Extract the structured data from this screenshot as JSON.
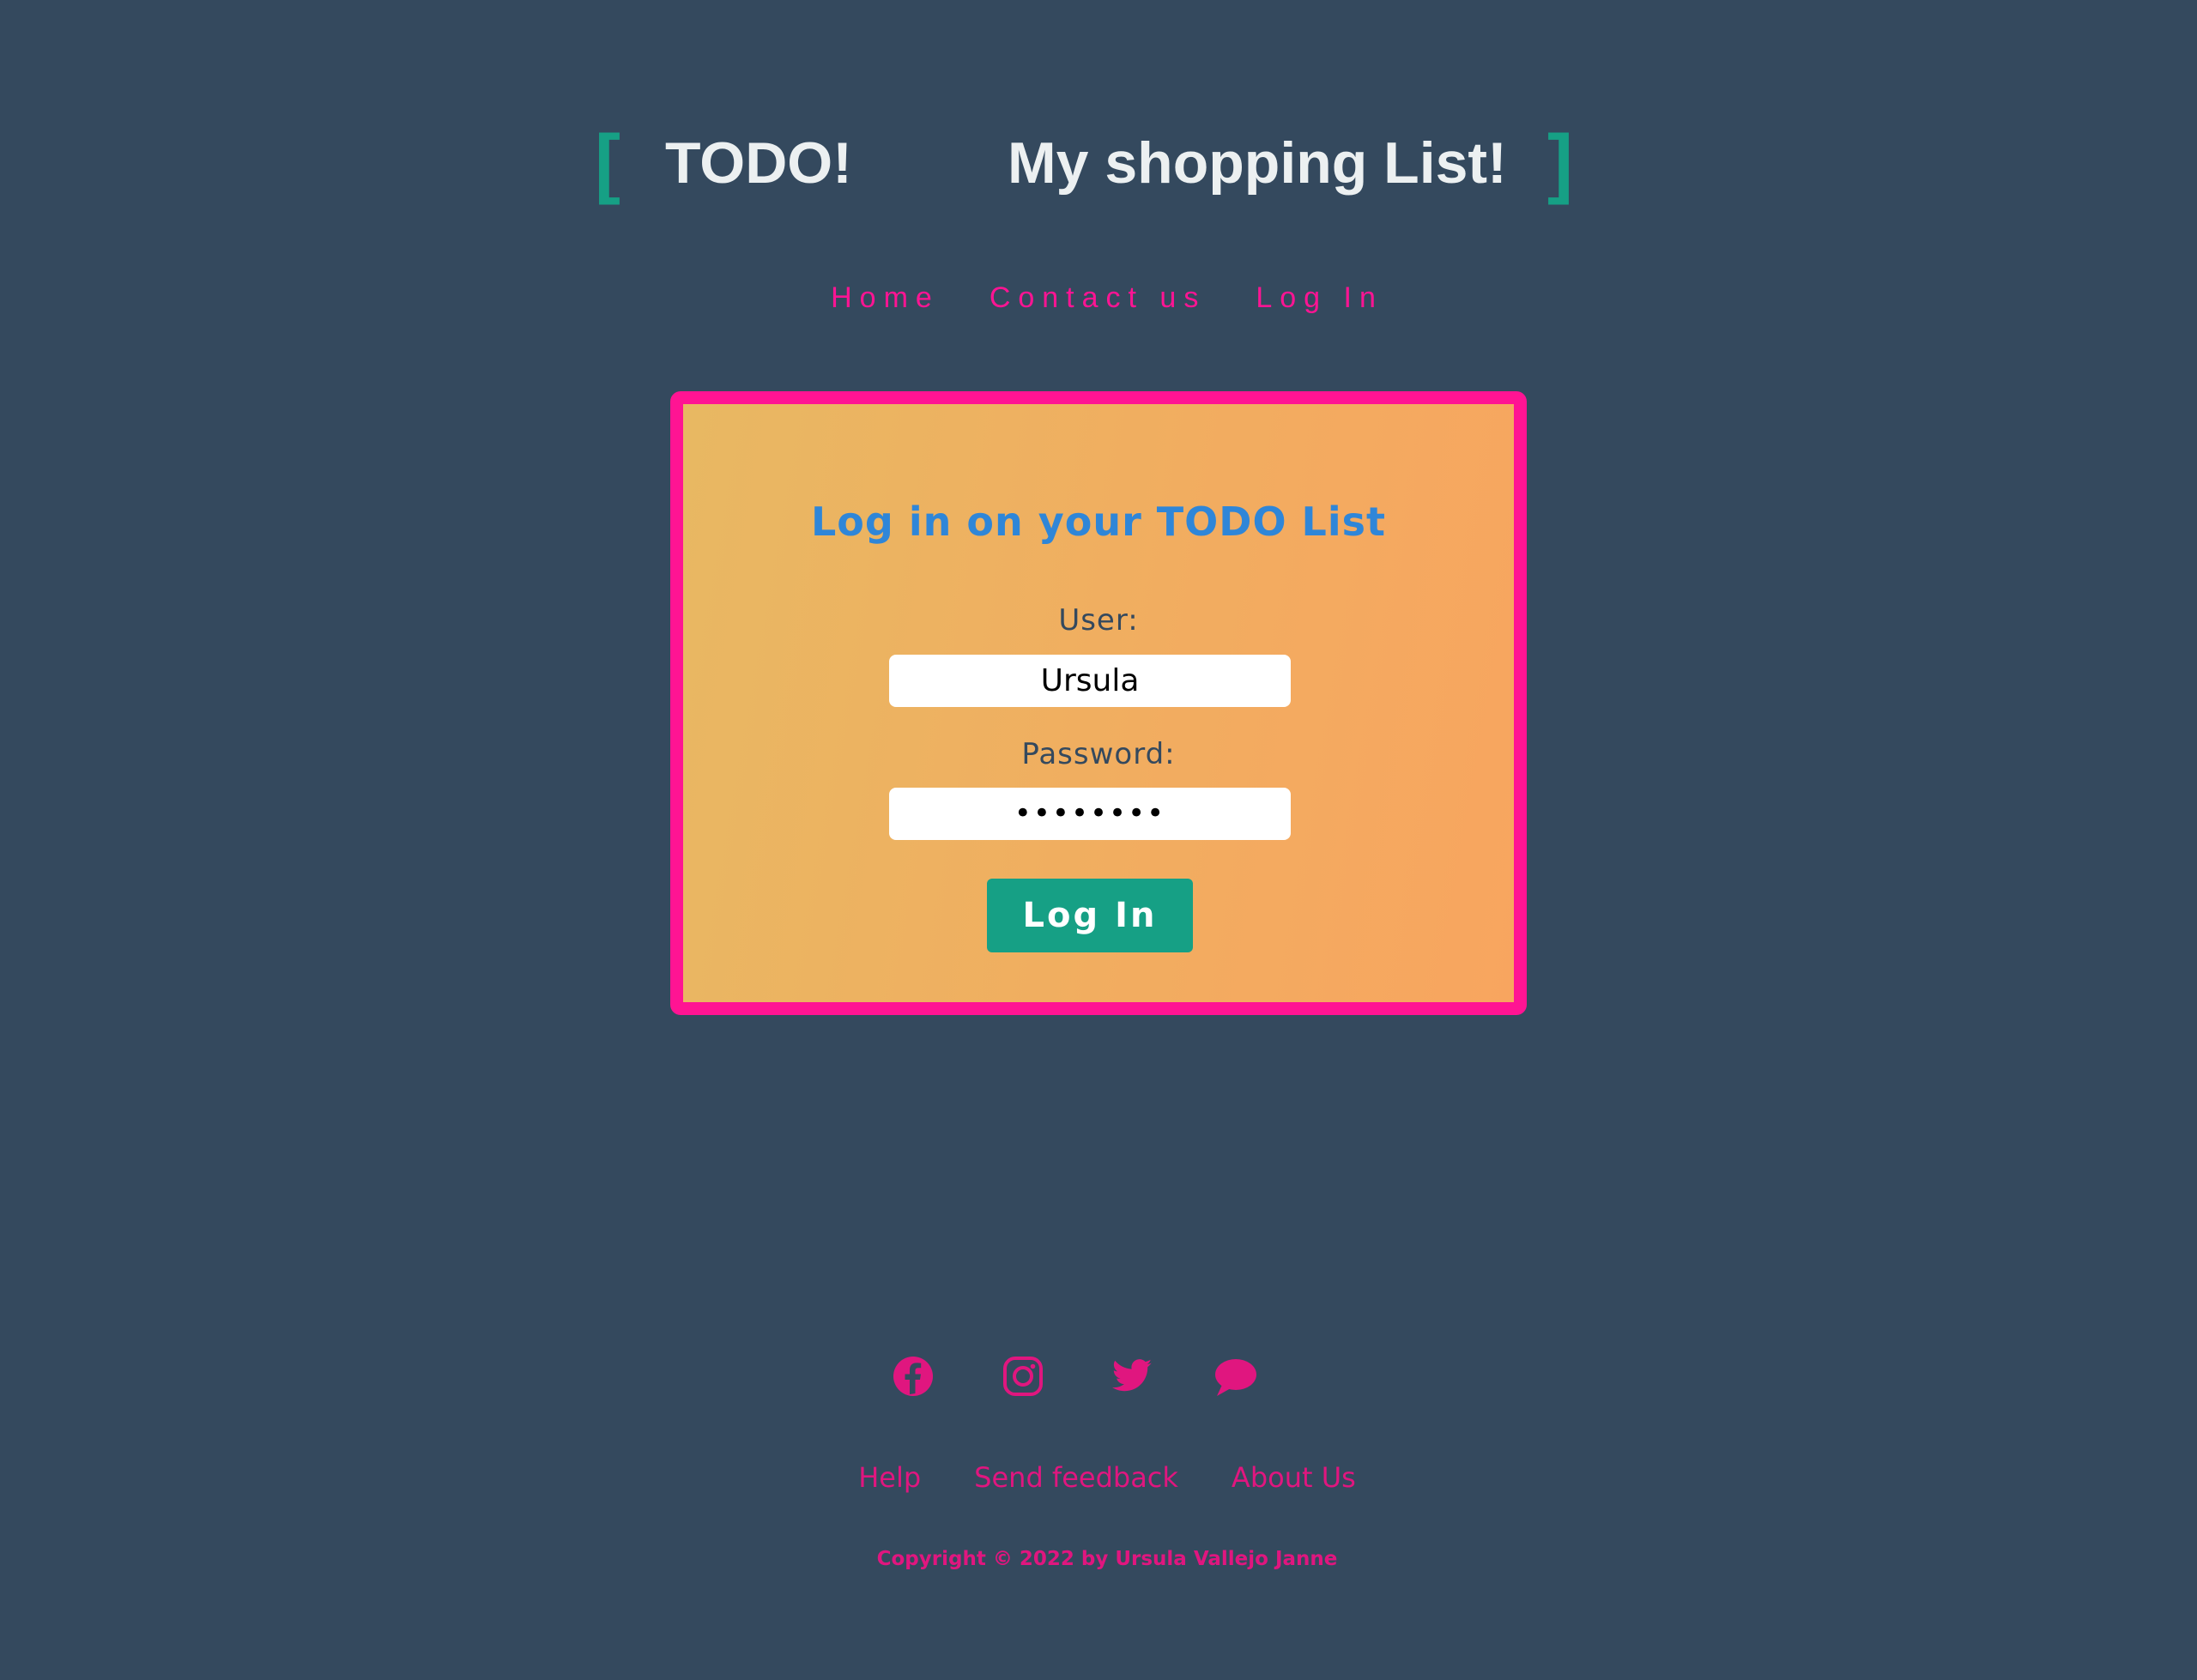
{
  "header": {
    "bracket_left": "[",
    "bracket_right": "]",
    "title_todo": "TODO!",
    "title_shopping": "My shopping List!"
  },
  "nav": {
    "items": [
      {
        "label": "Home"
      },
      {
        "label": "Contact us"
      },
      {
        "label": "Log In"
      }
    ]
  },
  "login": {
    "title": "Log in on your TODO List",
    "user_label": "User:",
    "user_value": "Ursula",
    "password_label": "Password:",
    "password_value": "••••••••",
    "button_label": "Log In"
  },
  "social": {
    "icons": [
      "facebook-icon",
      "instagram-icon",
      "twitter-icon",
      "chat-icon"
    ]
  },
  "footer": {
    "links": [
      {
        "label": "Help"
      },
      {
        "label": "Send feedback"
      },
      {
        "label": "About Us"
      }
    ],
    "copyright": "Copyright © 2022 by Ursula Vallejo Janne"
  },
  "colors": {
    "background": "#34495e",
    "accent_pink": "#ff1493",
    "accent_green": "#16a085",
    "title_blue": "#2f86d8",
    "footer_magenta": "#e0167f"
  }
}
